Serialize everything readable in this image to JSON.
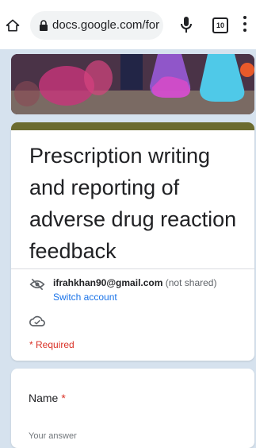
{
  "browser": {
    "url": "docs.google.com/for",
    "tab_count": "10",
    "icons": [
      "home-icon",
      "lock-icon",
      "mic-icon",
      "tabs-icon",
      "more-vert-icon"
    ]
  },
  "form": {
    "title": "Prescription writing and reporting of adverse drug reaction feedback",
    "account": {
      "email": "ifrahkhan90@gmail.com",
      "shared_note": "(not shared)",
      "switch_label": "Switch account"
    },
    "required_note": "* Required",
    "questions": [
      {
        "label": "Name",
        "required_mark": "*",
        "placeholder": "Your answer"
      }
    ]
  },
  "colors": {
    "theme_strip": "#6b6b2f",
    "link": "#1a73e8",
    "required": "#d93025",
    "page_bg": "#d6e2ee"
  }
}
